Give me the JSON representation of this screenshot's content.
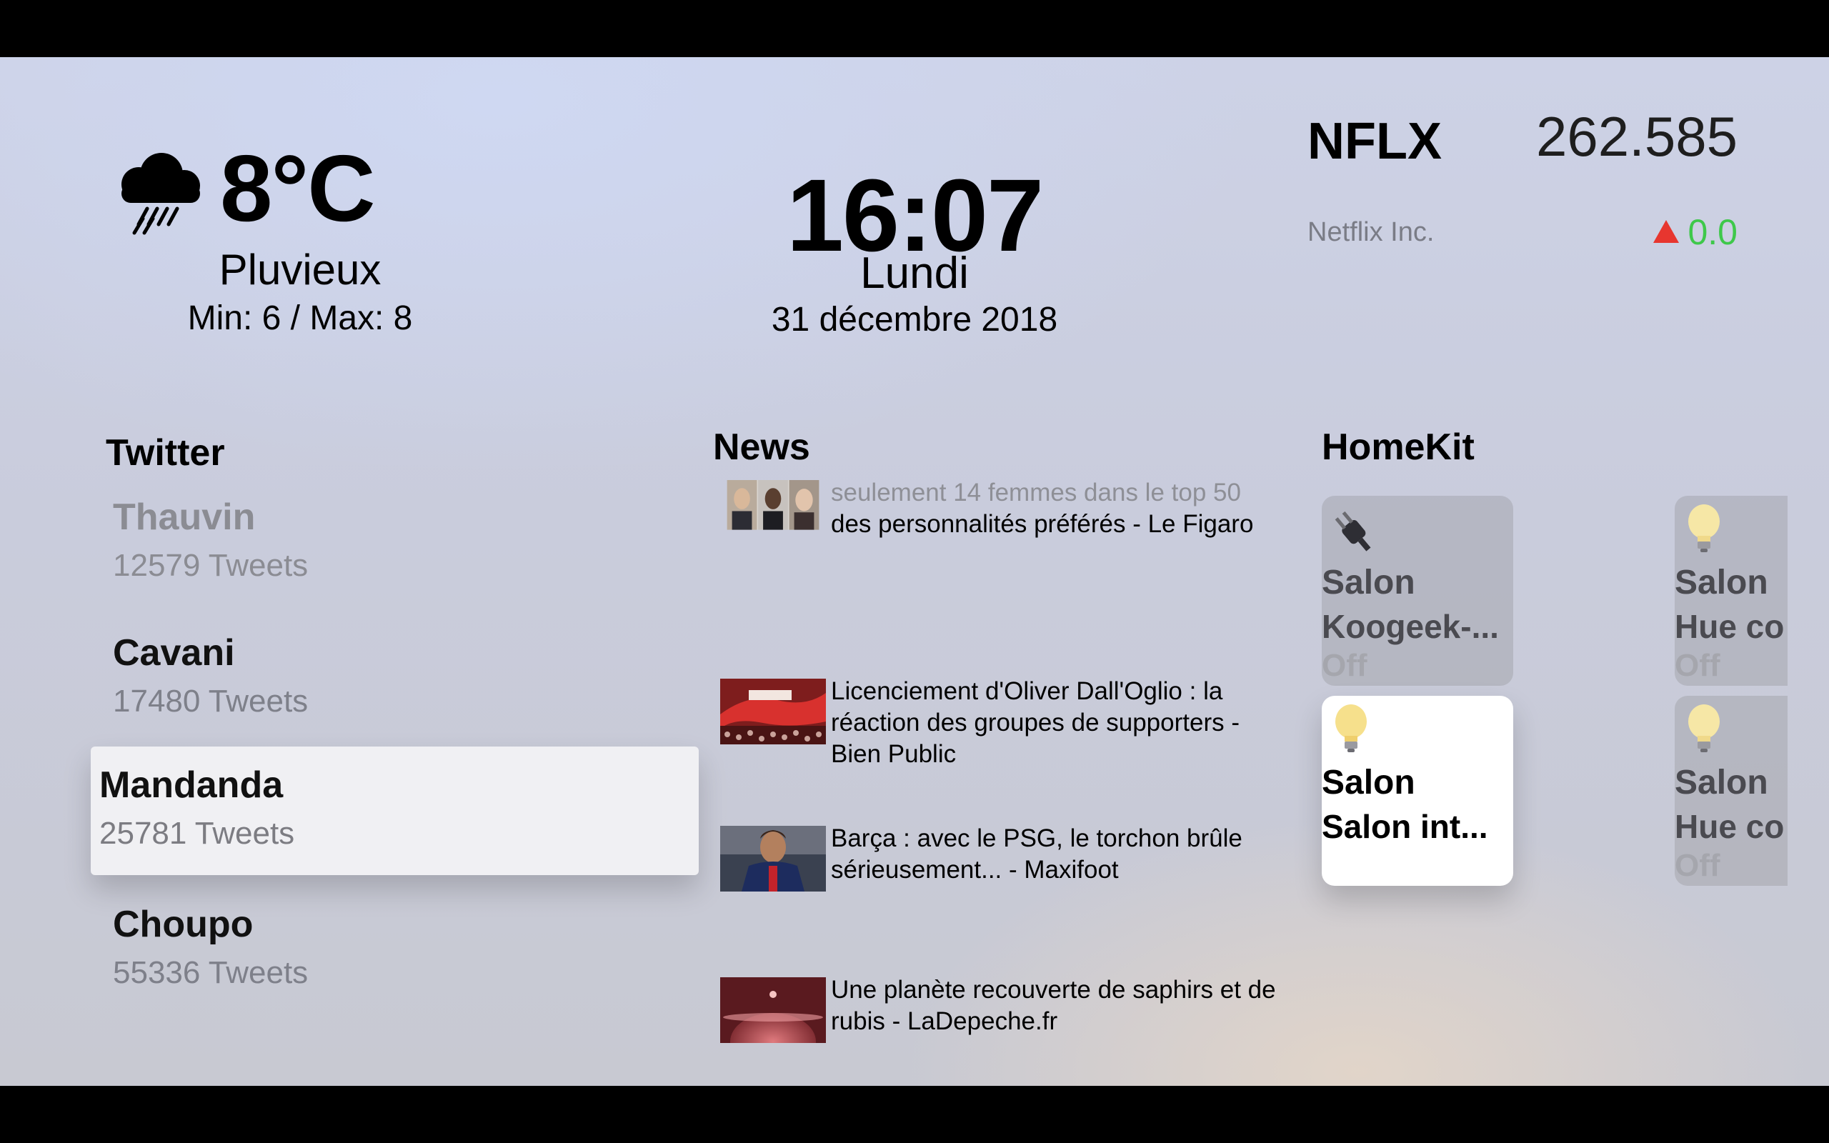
{
  "weather": {
    "icon": "rain-cloud-icon",
    "temperature": "8°C",
    "condition": "Pluvieux",
    "minmax": "Min: 6 / Max: 8"
  },
  "clock": {
    "time": "16:07",
    "day": "Lundi",
    "date": "31 décembre 2018"
  },
  "stock": {
    "symbol": "NFLX",
    "price": "262.585",
    "company": "Netflix Inc.",
    "change": "0.0",
    "change_color": "#3ec84a",
    "arrow_color": "#e7362f"
  },
  "twitter": {
    "title": "Twitter",
    "accounts": [
      {
        "name": "Thauvin",
        "count": "12579 Tweets"
      },
      {
        "name": "Cavani",
        "count": "17480 Tweets"
      },
      {
        "name": "Mandanda",
        "count": "25781 Tweets"
      },
      {
        "name": "Choupo",
        "count": "55336 Tweets"
      }
    ],
    "selected_index": 2
  },
  "news": {
    "title": "News",
    "articles": [
      {
        "line_faded": "seulement 14 femmes dans le top 50",
        "text": "des personnalités préférés - Le Figaro"
      },
      {
        "text": "Licenciement d'Oliver Dall'Oglio : la réaction des groupes de supporters - Bien Public"
      },
      {
        "text": "Barça : avec le PSG, le torchon brûle sérieusement... - Maxifoot"
      },
      {
        "text": "Une planète recouverte de saphirs et de rubis - LaDepeche.fr"
      }
    ]
  },
  "homekit": {
    "title": "HomeKit",
    "accessories": [
      {
        "room": "Salon",
        "name": "Koogeek-...",
        "state": "Off",
        "icon": "plug-icon"
      },
      {
        "room": "Salon",
        "name": "Hue co",
        "state": "Off",
        "icon": "lightbulb-icon"
      },
      {
        "room": "Salon",
        "name": "Salon int...",
        "state": "",
        "icon": "lightbulb-icon"
      },
      {
        "room": "Salon",
        "name": "Hue co",
        "state": "Off",
        "icon": "lightbulb-icon"
      }
    ]
  }
}
